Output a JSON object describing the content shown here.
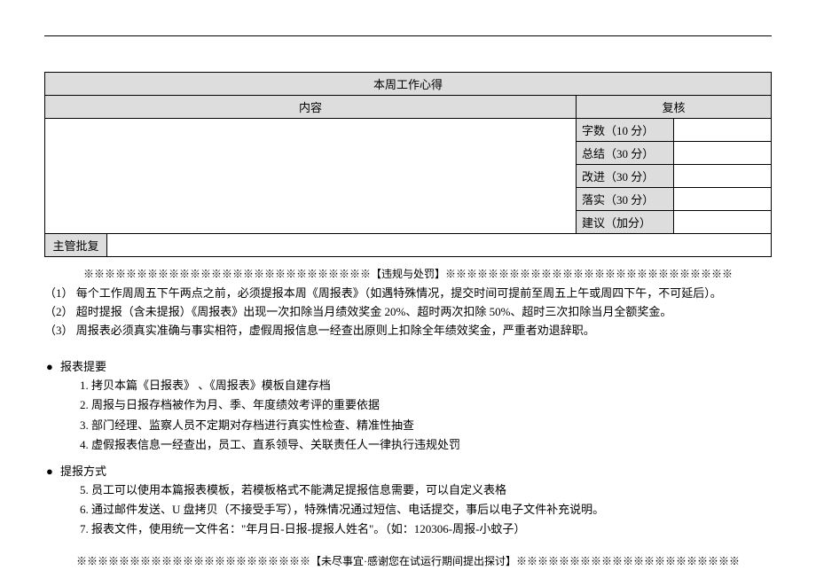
{
  "table": {
    "title": "本周工作心得",
    "content_header": "内容",
    "review_header": "复核",
    "scores": [
      {
        "label": "字数（10 分）"
      },
      {
        "label": "总结（30 分）"
      },
      {
        "label": "改进（30 分）"
      },
      {
        "label": "落实（30 分）"
      },
      {
        "label": "建议（加分）"
      }
    ],
    "manager_reply_label": "主管批复"
  },
  "violations_divider": "※※※※※※※※※※※※※※※※※※※※※※※※※※※【违规与处罚】※※※※※※※※※※※※※※※※※※※※※※※※※※※",
  "violations": [
    "（1） 每个工作周周五下午两点之前，必须提报本周《周报表》（如遇特殊情况，提交时间可提前至周五上午或周四下午，不可延后）。",
    "（2） 超时提报（含未提报）《周报表》出现一次扣除当月绩效奖金 20%、超时两次扣除 50%、超时三次扣除当月全额奖金。",
    "（3） 周报表必须真实准确与事实相符，虚假周报信息一经查出原则上扣除全年绩效奖金，严重者劝退辞职。"
  ],
  "sections": [
    {
      "title": "报表提要",
      "items": [
        "1.  拷贝本篇《日报表》 、《周报表》模板自建存档",
        "2.  周报与日报存档被作为月、季、年度绩效考评的重要依据",
        "3.  部门经理、监察人员不定期对存档进行真实性检查、精准性抽查",
        "4.  虚假报表信息一经查出，员工、直系领导、关联责任人一律执行违规处罚"
      ]
    },
    {
      "title": "提报方式",
      "items": [
        "5.  员工可以使用本篇报表模板，若模板格式不能满足提报信息需要，可以自定义表格",
        "6.  通过邮件发送、U 盘拷贝（不接受手写），特殊情况通过短信、电话提交，事后以电子文件补充说明。",
        "7.  报表文件，使用统一文件名：\"年月日-日报-提报人姓名\"。（如：120306-周报-小蚊子）"
      ]
    }
  ],
  "closing_divider": "※※※※※※※※※※※※※※※※※※※※※※【未尽事宜·感谢您在试运行期间提出探讨】※※※※※※※※※※※※※※※※※※※※※"
}
